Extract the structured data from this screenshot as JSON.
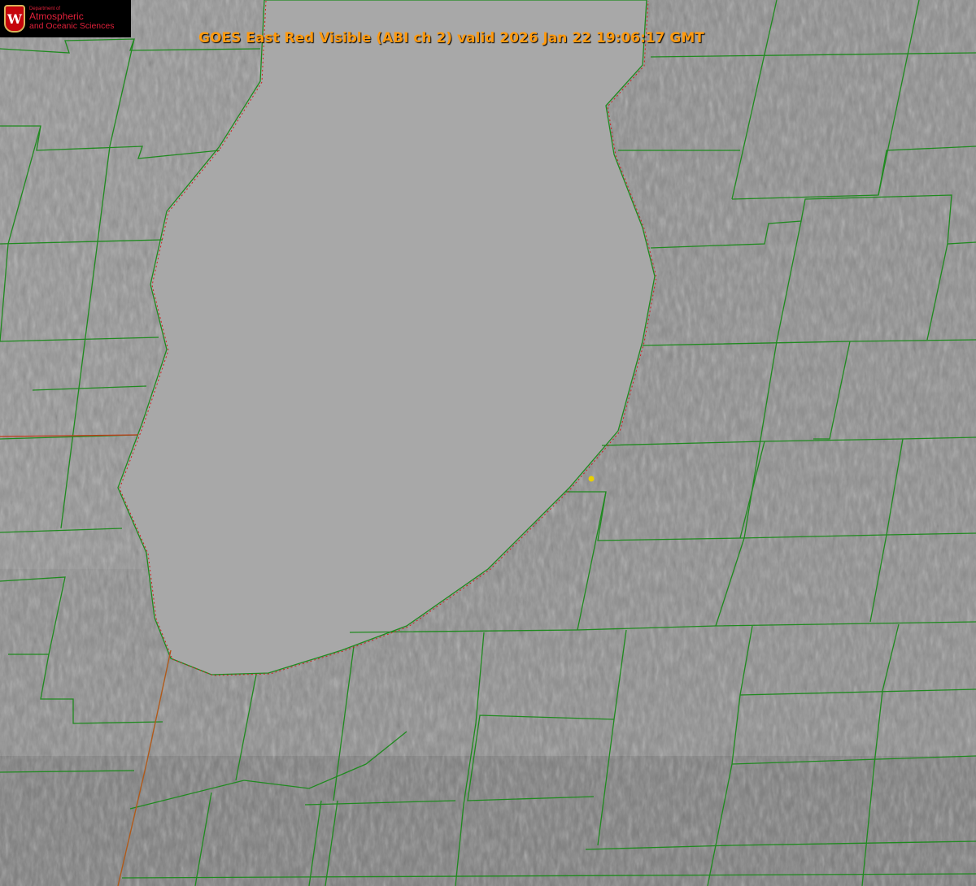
{
  "header": {
    "title": "GOES East Red Visible (ABI ch 2) valid 2026 Jan 22 19:06:17 GMT"
  },
  "logo": {
    "department": "Department of",
    "line1": "Atmospheric",
    "line2": "and Oceanic Sciences",
    "crest_letter": "W"
  },
  "colors": {
    "boundary": "#1f8a1f",
    "shoreline_dotted": "#d02020",
    "title": "#ff9a10",
    "marker": "#e8d000"
  }
}
